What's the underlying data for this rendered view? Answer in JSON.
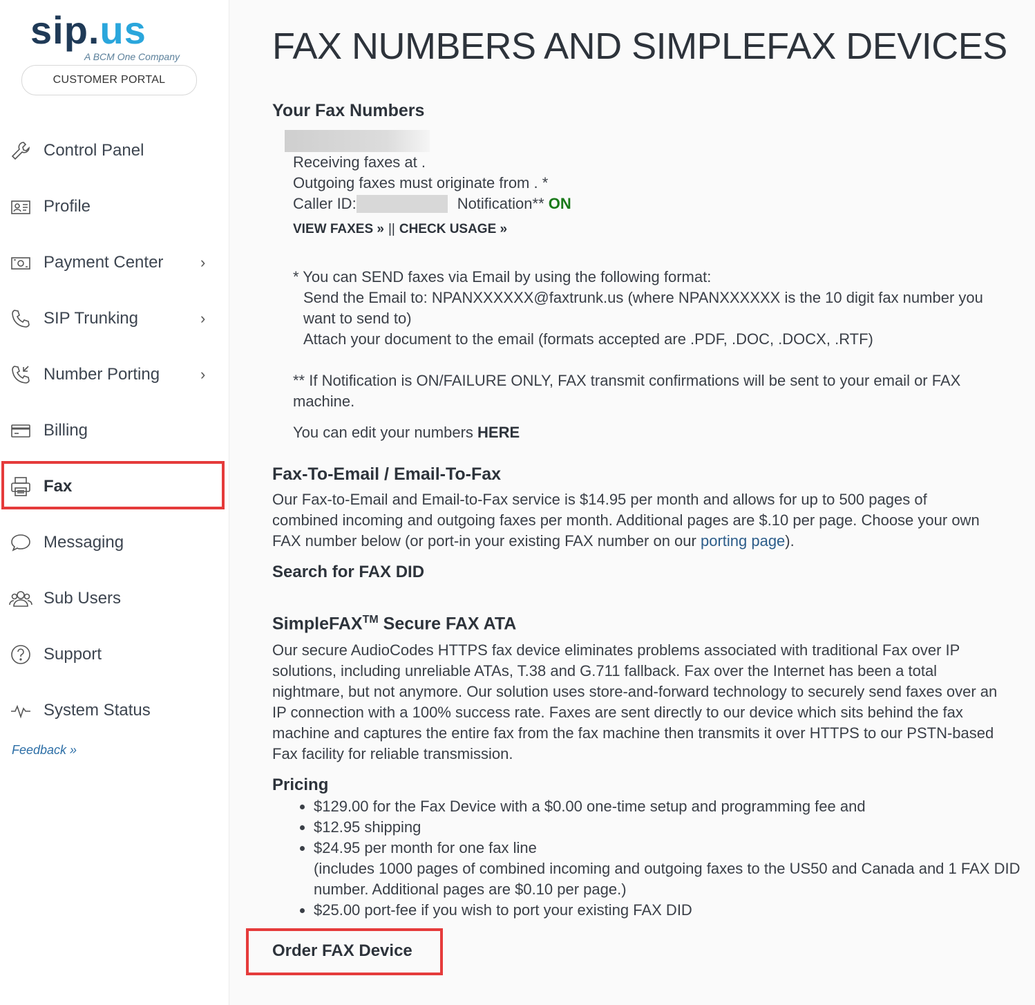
{
  "logo": {
    "brand_main": "sip",
    "brand_accent": "us",
    "tagline": "A BCM One Company"
  },
  "portal_label": "CUSTOMER PORTAL",
  "nav": [
    {
      "label": "Control Panel",
      "icon": "wrench-icon",
      "has_chevron": false
    },
    {
      "label": "Profile",
      "icon": "id-card-icon",
      "has_chevron": false
    },
    {
      "label": "Payment Center",
      "icon": "money-icon",
      "has_chevron": true
    },
    {
      "label": "SIP Trunking",
      "icon": "phone-icon",
      "has_chevron": true
    },
    {
      "label": "Number Porting",
      "icon": "phone-incoming-icon",
      "has_chevron": true
    },
    {
      "label": "Billing",
      "icon": "credit-card-icon",
      "has_chevron": false
    },
    {
      "label": "Fax",
      "icon": "printer-icon",
      "has_chevron": false,
      "active": true
    },
    {
      "label": "Messaging",
      "icon": "chat-bubble-icon",
      "has_chevron": false
    },
    {
      "label": "Sub Users",
      "icon": "users-icon",
      "has_chevron": false
    },
    {
      "label": "Support",
      "icon": "help-circle-icon",
      "has_chevron": false
    },
    {
      "label": "System Status",
      "icon": "pulse-icon",
      "has_chevron": false
    }
  ],
  "chevron": "›",
  "feedback": "Feedback »",
  "main": {
    "title": "FAX NUMBERS AND SIMPLEFAX DEVICES",
    "your_numbers": {
      "heading": "Your Fax Numbers",
      "receiving": "Receiving faxes at .",
      "outgoing": "Outgoing faxes must originate from . *",
      "caller_id_label": "Caller ID:",
      "notification_label": "Notification**",
      "notification_value": "ON",
      "view_faxes": "VIEW FAXES »",
      "separator": "||",
      "check_usage": "CHECK USAGE »",
      "note1_intro": "* You can SEND faxes via Email by using the following format:",
      "note1_line1": "Send the Email to: NPANXXXXXX@faxtrunk.us (where NPANXXXXXX is the 10 digit fax number you want to send to)",
      "note1_line2": "Attach your document to the email (formats accepted are .PDF, .DOC, .DOCX, .RTF)",
      "note2": "** If Notification is ON/FAILURE ONLY, FAX transmit confirmations will be sent to your email or FAX machine.",
      "edit_text": "You can edit your numbers",
      "edit_link": "HERE"
    },
    "fax_to_email": {
      "heading": "Fax-To-Email / Email-To-Fax",
      "body_before": "Our Fax-to-Email and Email-to-Fax service is $14.95 per month and allows for up to 500 pages of combined incoming and outgoing faxes per month. Additional pages are $.10 per page. Choose your own FAX number below (or port-in your existing FAX number on our",
      "porting_link": "porting page",
      "body_after": ").",
      "search_link": "Search for FAX DID"
    },
    "simplefax": {
      "heading_prefix": "SimpleFAX",
      "heading_tm": "TM",
      "heading_suffix": " Secure FAX ATA",
      "body": "Our secure AudioCodes HTTPS fax device eliminates problems associated with traditional Fax over IP solutions, including unreliable ATAs, T.38 and G.711 fallback. Fax over the Internet has been a total nightmare, but not anymore. Our solution uses store-and-forward technology to securely send faxes over an IP connection with a 100% success rate. Faxes are sent directly to our device which sits behind the fax machine and captures the entire fax from the fax machine then transmits it over HTTPS to our PSTN-based Fax facility for reliable transmission.",
      "pricing_heading": "Pricing",
      "pricing": [
        "$129.00 for the Fax Device with a $0.00 one-time setup and programming fee and",
        "$12.95 shipping",
        "$24.95 per month for one fax line",
        "$25.00 port-fee if you wish to port your existing FAX DID"
      ],
      "pricing_sub": "(includes 1000 pages of combined incoming and outgoing faxes to the US50 and Canada and 1 FAX DID number. Additional pages are $0.10 per page.)",
      "order_button": "Order FAX Device"
    }
  },
  "colors": {
    "highlight": "#e53b3b",
    "on_green": "#1b7a1b",
    "brand_dark": "#1f3a57",
    "brand_light": "#2aa6dc"
  }
}
